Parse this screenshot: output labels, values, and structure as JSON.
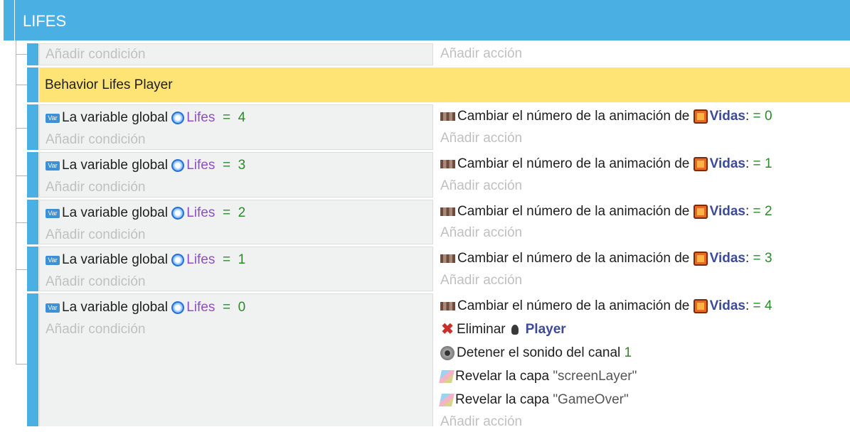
{
  "group": {
    "title": "LIFES"
  },
  "placeholders": {
    "add_condition": "Añadir condición",
    "add_action": "Añadir acción"
  },
  "comment": {
    "text": "Behavior Lifes Player",
    "color": "#fde474"
  },
  "conditions": [
    {
      "prefix": "La variable global",
      "variable": "Lifes",
      "operator": "=",
      "value": "4"
    },
    {
      "prefix": "La variable global",
      "variable": "Lifes",
      "operator": "=",
      "value": "3"
    },
    {
      "prefix": "La variable global",
      "variable": "Lifes",
      "operator": "=",
      "value": "2"
    },
    {
      "prefix": "La variable global",
      "variable": "Lifes",
      "operator": "=",
      "value": "1"
    },
    {
      "prefix": "La variable global",
      "variable": "Lifes",
      "operator": "=",
      "value": "0"
    }
  ],
  "anim_actions": [
    {
      "text": "Cambiar el número de la animación de",
      "object": "Vidas",
      "colon": ":",
      "operator": "=",
      "value": "0"
    },
    {
      "text": "Cambiar el número de la animación de",
      "object": "Vidas",
      "colon": ":",
      "operator": "=",
      "value": "1"
    },
    {
      "text": "Cambiar el número de la animación de",
      "object": "Vidas",
      "colon": ":",
      "operator": "=",
      "value": "2"
    },
    {
      "text": "Cambiar el número de la animación de",
      "object": "Vidas",
      "colon": ":",
      "operator": "=",
      "value": "3"
    },
    {
      "text": "Cambiar el número de la animación de",
      "object": "Vidas",
      "colon": ":",
      "operator": "=",
      "value": "4"
    }
  ],
  "extra_actions": {
    "delete": {
      "text": "Eliminar",
      "object": "Player"
    },
    "stop_sound": {
      "text": "Detener el sonido del canal",
      "value": "1"
    },
    "reveal1": {
      "text": "Revelar la capa",
      "value": "\"screenLayer\""
    },
    "reveal2": {
      "text": "Revelar la capa",
      "value": "\"GameOver\""
    }
  },
  "icons": [
    "variable-icon",
    "global-variable-icon",
    "animation-icon",
    "sprite-icon",
    "delete-icon",
    "player-icon",
    "speaker-icon",
    "layer-icon"
  ],
  "colors": {
    "group_header": "#4aafe3",
    "comment_bg": "#fde474",
    "variable": "#8e4fc4",
    "number": "#2c8a2c",
    "object": "#3c4a9a"
  }
}
